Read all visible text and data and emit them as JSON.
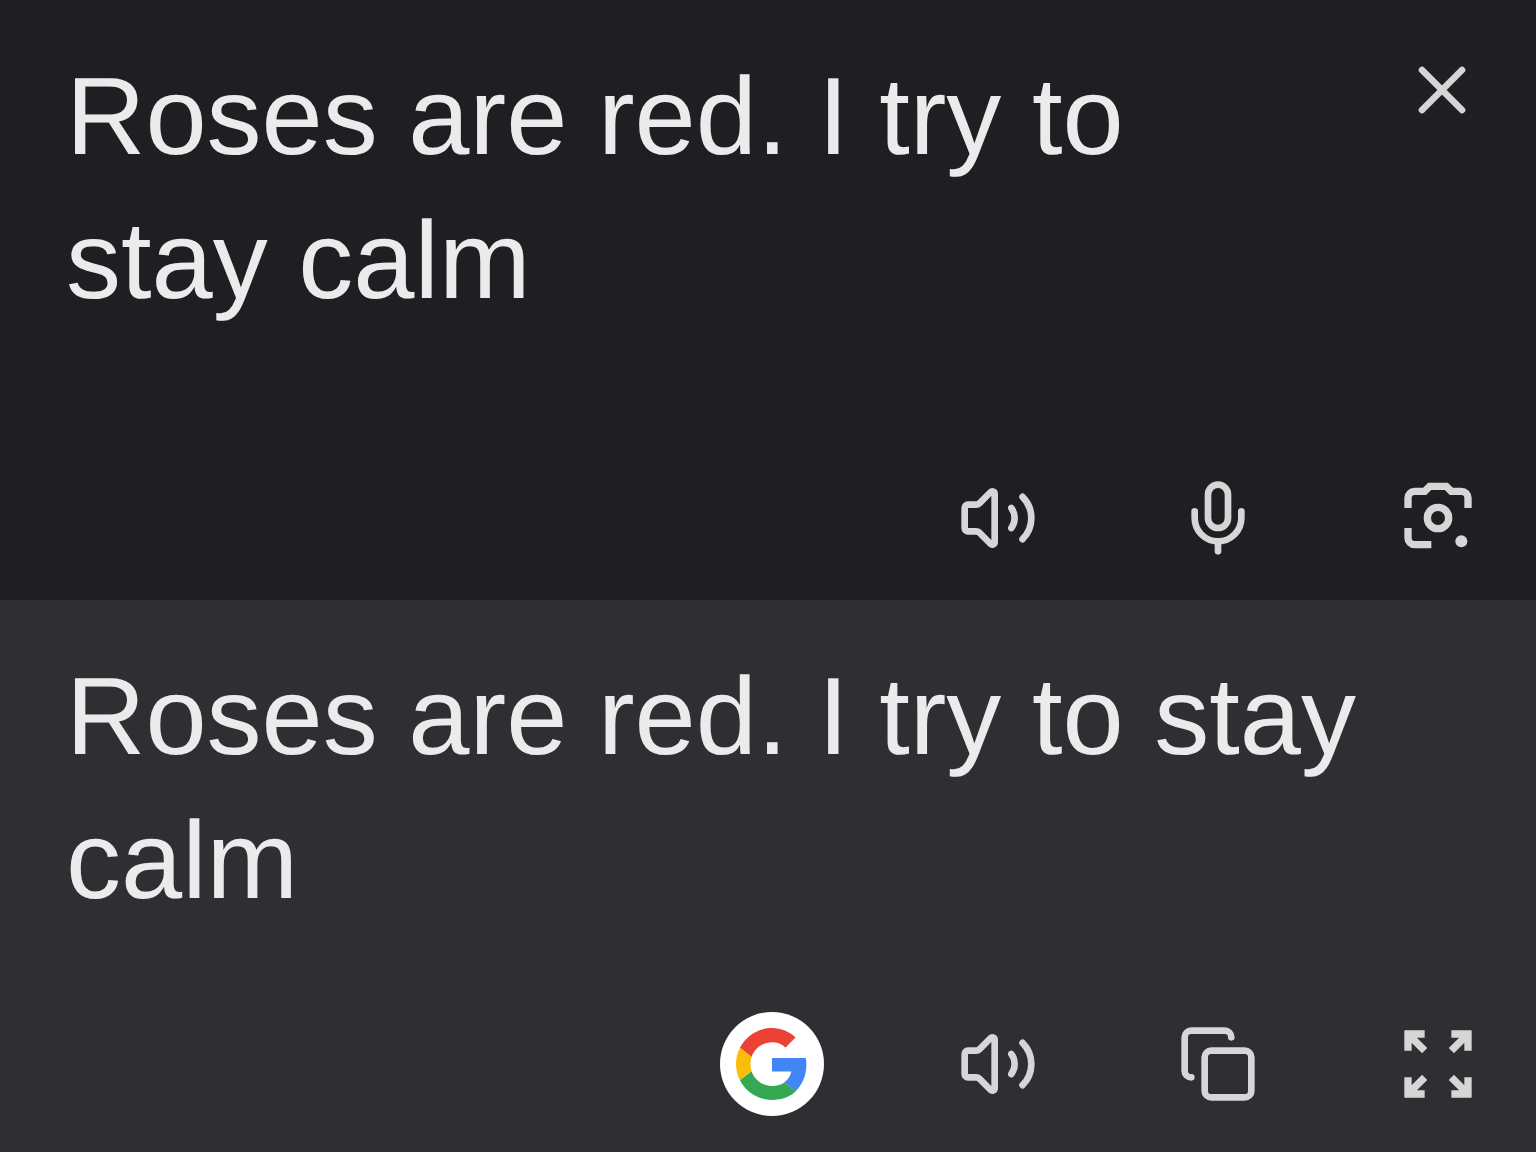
{
  "source": {
    "text": "Roses are red. I try to stay calm"
  },
  "translation": {
    "text": "Roses are red. I try to stay calm"
  }
}
